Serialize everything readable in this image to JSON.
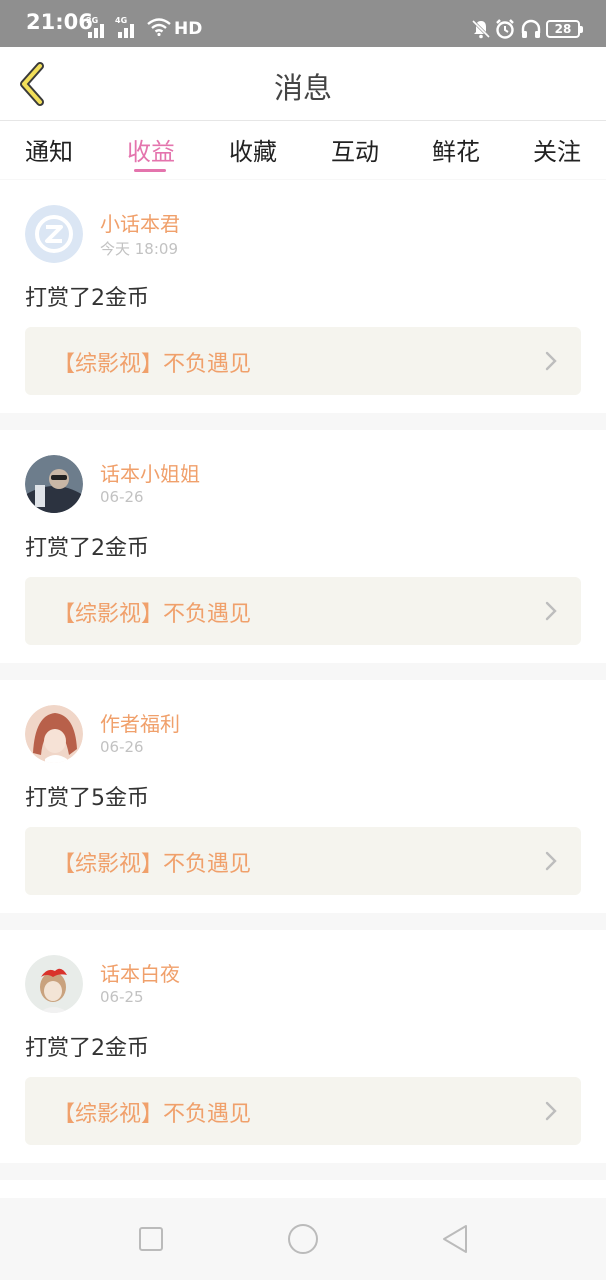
{
  "status": {
    "time": "21:06",
    "net_2g": "2G",
    "net_4g": "4G",
    "hd": "HD",
    "battery": "28"
  },
  "header": {
    "title": "消息"
  },
  "tabs": [
    {
      "label": "通知"
    },
    {
      "label": "收益"
    },
    {
      "label": "收藏"
    },
    {
      "label": "互动"
    },
    {
      "label": "鲜花"
    },
    {
      "label": "关注"
    }
  ],
  "active_tab": "收益",
  "messages": [
    {
      "user": "小话本君",
      "time": "今天 18:09",
      "text": "打赏了2金币",
      "book": "【综影视】不负遇见"
    },
    {
      "user": "话本小姐姐",
      "time": "06-26",
      "text": "打赏了2金币",
      "book": "【综影视】不负遇见"
    },
    {
      "user": "作者福利",
      "time": "06-26",
      "text": "打赏了5金币",
      "book": "【综影视】不负遇见"
    },
    {
      "user": "话本白夜",
      "time": "06-25",
      "text": "打赏了2金币",
      "book": "【综影视】不负遇见"
    }
  ],
  "colors": {
    "accent": "#e474ad",
    "name": "#f0a06b",
    "book_bg": "#f5f4ee",
    "statusbar": "#8f8f8f"
  }
}
